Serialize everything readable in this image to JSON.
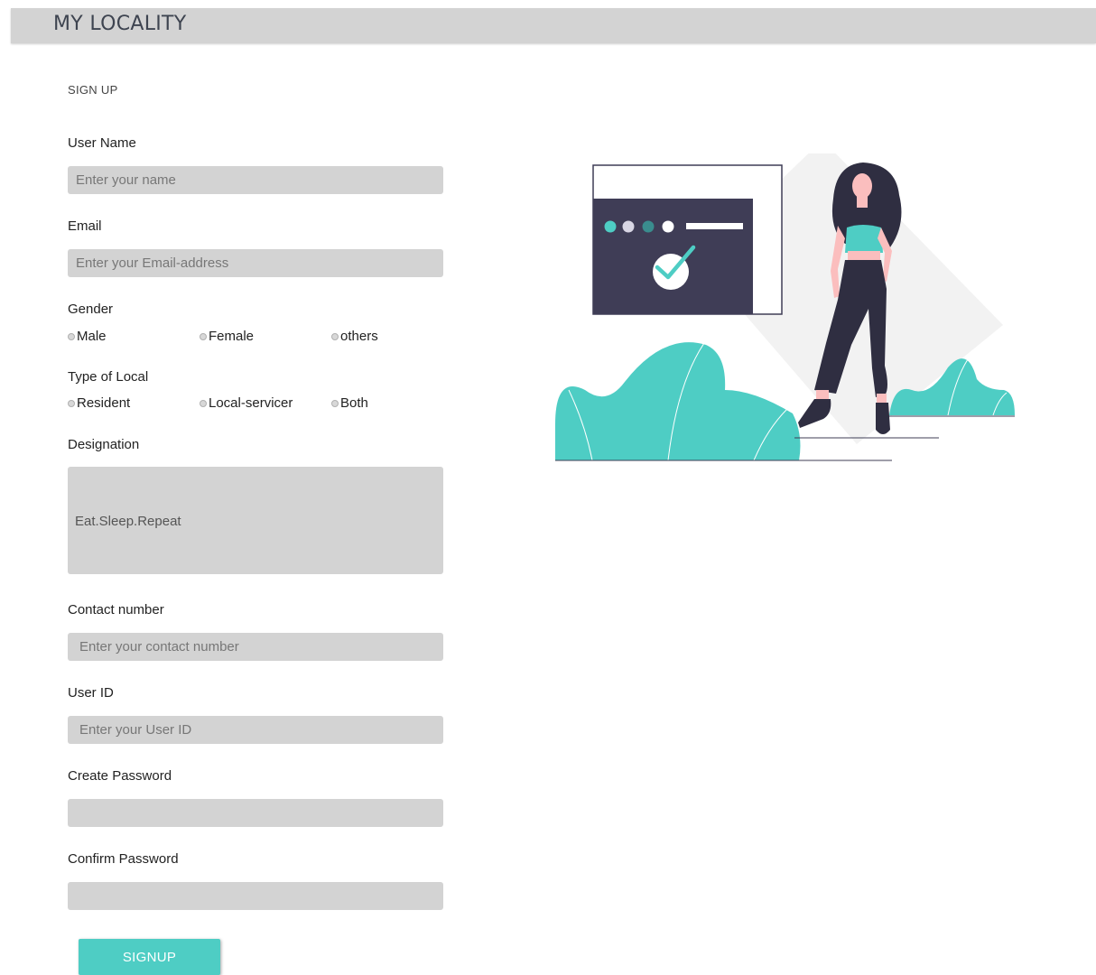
{
  "header": {
    "brand": "MY LOCALITY"
  },
  "form": {
    "title": "SIGN UP",
    "username": {
      "label": "User Name",
      "placeholder": "Enter your name"
    },
    "email": {
      "label": "Email",
      "placeholder": "Enter your Email-address"
    },
    "gender": {
      "label": "Gender",
      "options": [
        "Male",
        "Female",
        "others"
      ]
    },
    "local_type": {
      "label": "Type of Local",
      "options": [
        "Resident",
        "Local-servicer",
        "Both"
      ]
    },
    "designation": {
      "label": "Designation",
      "value": "Eat.Sleep.Repeat"
    },
    "contact": {
      "label": "Contact number",
      "placeholder": "Enter your contact number"
    },
    "userid": {
      "label": "User ID",
      "placeholder": "Enter your User ID"
    },
    "password": {
      "label": "Create Password",
      "placeholder": ""
    },
    "confirm": {
      "label": "Confirm Password",
      "placeholder": ""
    },
    "submit_label": "SIGNUP"
  },
  "colors": {
    "accent": "#4ecdc4",
    "field_bg": "#d3d3d3",
    "header_bg": "#d3d3d3",
    "illustration_dark": "#3f3d56",
    "illustration_figure": "#2f2e41",
    "illustration_skin": "#fbbebe"
  }
}
